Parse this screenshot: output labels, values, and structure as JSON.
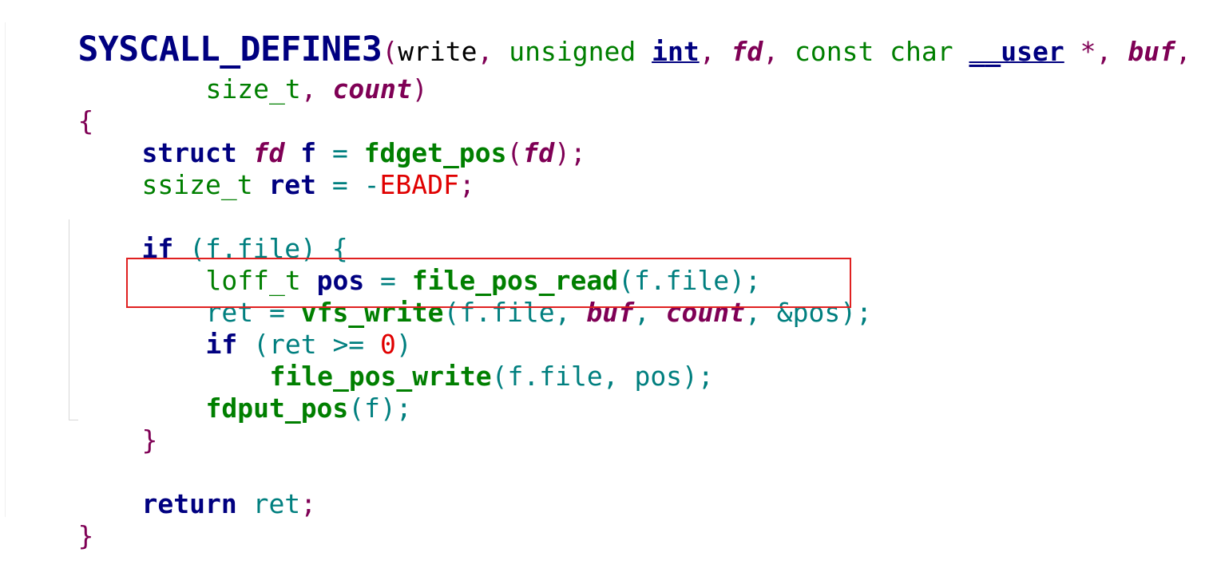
{
  "code": {
    "line1": {
      "macro": "SYSCALL_DEFINE3",
      "open_paren": "(",
      "name": "write",
      "comma1": ", ",
      "unsigned": "unsigned",
      "sp1": " ",
      "int": "int",
      "comma2": ", ",
      "fd": "fd",
      "comma3": ", ",
      "const_char": "const char",
      "sp2": " ",
      "user": "__user",
      "star": " *",
      "comma4": ", ",
      "buf": "buf",
      "comma5": ","
    },
    "line2": {
      "size_t": "size_t",
      "comma": ", ",
      "count": "count",
      "close_paren": ")"
    },
    "line3": {
      "brace": "{"
    },
    "line4": {
      "struct": "struct",
      "fd": "fd",
      "f": "f",
      "eq": " = ",
      "func": "fdget_pos",
      "open": "(",
      "arg": "fd",
      "close": ");"
    },
    "line5": {
      "type": "ssize_t",
      "ret": "ret",
      "eq": " = -",
      "const": "EBADF",
      "semi": ";"
    },
    "line6": {
      "if": "if",
      "cond": " (f.file) {"
    },
    "line7": {
      "type": "loff_t",
      "pos": "pos",
      "eq": " = ",
      "func": "file_pos_read",
      "args": "(f.file);"
    },
    "line8": {
      "ret": "ret",
      "eq": " = ",
      "func": "vfs_write",
      "args1": "(f.file, ",
      "buf": "buf",
      "comma": ", ",
      "count": "count",
      "args2": ", &pos);"
    },
    "line9": {
      "if": "if",
      "cond1": " (ret >= ",
      "zero": "0",
      "cond2": ")"
    },
    "line10": {
      "func": "file_pos_write",
      "args": "(f.file, pos);"
    },
    "line11": {
      "func": "fdput_pos",
      "args": "(f);"
    },
    "line12": {
      "brace": "}"
    },
    "line13": {
      "return": "return",
      "ret": " ret",
      "semi": ";"
    },
    "line14": {
      "brace": "}"
    }
  },
  "colors": {
    "macro": "#000080",
    "keyword": "#000080",
    "type": "#007f00",
    "param": "#7f0055",
    "variable": "#007f7f",
    "constant": "#e00000",
    "highlight_border": "#e02020"
  }
}
